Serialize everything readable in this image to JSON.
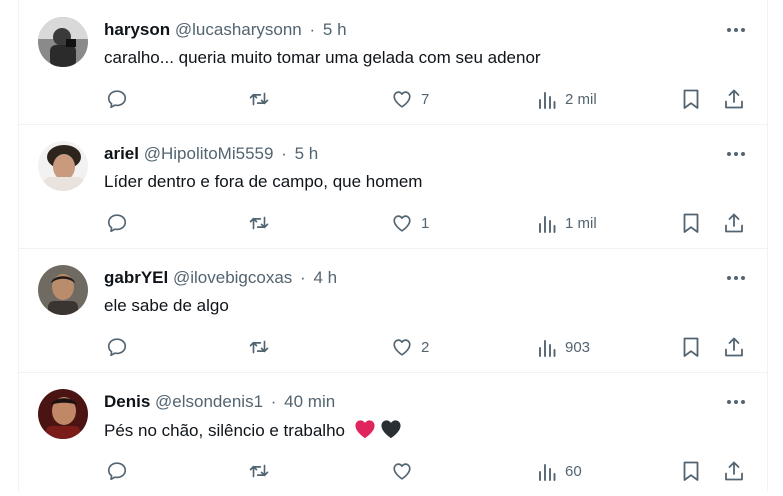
{
  "colors": {
    "icon": "#536471",
    "text": "#0f1419",
    "muted": "#536471",
    "border": "#eff3f4",
    "red_heart": "#e0245e",
    "black_heart": "#292f33"
  },
  "replies": [
    {
      "name": "haryson",
      "handle": "@lucasharysonn",
      "time": "5 h",
      "text": "caralho... queria muito tomar uma gelada com seu adenor",
      "likes": "7",
      "views": "2 mil",
      "avatar_icon": "avatar-haryson"
    },
    {
      "name": "ariel",
      "handle": "@HipolitoMi5559",
      "time": "5 h",
      "text": "Líder dentro e fora de campo, que homem",
      "likes": "1",
      "views": "1 mil",
      "avatar_icon": "avatar-ariel"
    },
    {
      "name": "gabrYEl",
      "handle": "@ilovebigcoxas",
      "time": "4 h",
      "text": "ele sabe de algo",
      "likes": "2",
      "views": "903",
      "avatar_icon": "avatar-gabryel"
    },
    {
      "name": "Denis",
      "handle": "@elsondenis1",
      "time": "40 min",
      "text": "Pés no chão, silêncio e trabalho",
      "likes": "",
      "views": "60",
      "avatar_icon": "avatar-denis",
      "emoji": [
        "red-heart",
        "black-heart"
      ]
    }
  ],
  "separator": "·"
}
